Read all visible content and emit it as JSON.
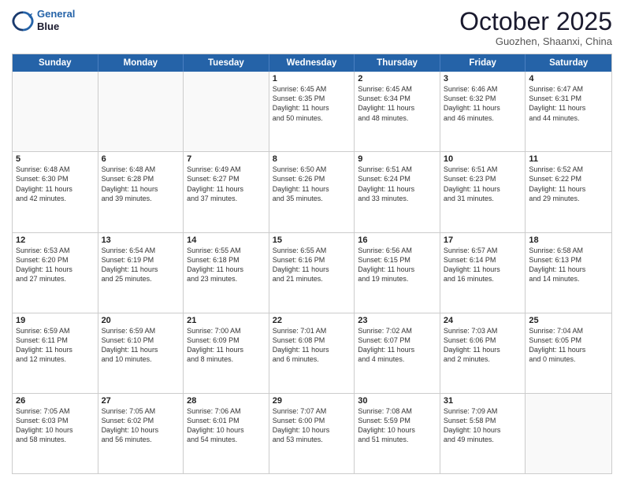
{
  "logo": {
    "line1": "General",
    "line2": "Blue"
  },
  "title": "October 2025",
  "subtitle": "Guozhen, Shaanxi, China",
  "dayHeaders": [
    "Sunday",
    "Monday",
    "Tuesday",
    "Wednesday",
    "Thursday",
    "Friday",
    "Saturday"
  ],
  "weeks": [
    [
      {
        "day": "",
        "info": ""
      },
      {
        "day": "",
        "info": ""
      },
      {
        "day": "",
        "info": ""
      },
      {
        "day": "1",
        "info": "Sunrise: 6:45 AM\nSunset: 6:35 PM\nDaylight: 11 hours\nand 50 minutes."
      },
      {
        "day": "2",
        "info": "Sunrise: 6:45 AM\nSunset: 6:34 PM\nDaylight: 11 hours\nand 48 minutes."
      },
      {
        "day": "3",
        "info": "Sunrise: 6:46 AM\nSunset: 6:32 PM\nDaylight: 11 hours\nand 46 minutes."
      },
      {
        "day": "4",
        "info": "Sunrise: 6:47 AM\nSunset: 6:31 PM\nDaylight: 11 hours\nand 44 minutes."
      }
    ],
    [
      {
        "day": "5",
        "info": "Sunrise: 6:48 AM\nSunset: 6:30 PM\nDaylight: 11 hours\nand 42 minutes."
      },
      {
        "day": "6",
        "info": "Sunrise: 6:48 AM\nSunset: 6:28 PM\nDaylight: 11 hours\nand 39 minutes."
      },
      {
        "day": "7",
        "info": "Sunrise: 6:49 AM\nSunset: 6:27 PM\nDaylight: 11 hours\nand 37 minutes."
      },
      {
        "day": "8",
        "info": "Sunrise: 6:50 AM\nSunset: 6:26 PM\nDaylight: 11 hours\nand 35 minutes."
      },
      {
        "day": "9",
        "info": "Sunrise: 6:51 AM\nSunset: 6:24 PM\nDaylight: 11 hours\nand 33 minutes."
      },
      {
        "day": "10",
        "info": "Sunrise: 6:51 AM\nSunset: 6:23 PM\nDaylight: 11 hours\nand 31 minutes."
      },
      {
        "day": "11",
        "info": "Sunrise: 6:52 AM\nSunset: 6:22 PM\nDaylight: 11 hours\nand 29 minutes."
      }
    ],
    [
      {
        "day": "12",
        "info": "Sunrise: 6:53 AM\nSunset: 6:20 PM\nDaylight: 11 hours\nand 27 minutes."
      },
      {
        "day": "13",
        "info": "Sunrise: 6:54 AM\nSunset: 6:19 PM\nDaylight: 11 hours\nand 25 minutes."
      },
      {
        "day": "14",
        "info": "Sunrise: 6:55 AM\nSunset: 6:18 PM\nDaylight: 11 hours\nand 23 minutes."
      },
      {
        "day": "15",
        "info": "Sunrise: 6:55 AM\nSunset: 6:16 PM\nDaylight: 11 hours\nand 21 minutes."
      },
      {
        "day": "16",
        "info": "Sunrise: 6:56 AM\nSunset: 6:15 PM\nDaylight: 11 hours\nand 19 minutes."
      },
      {
        "day": "17",
        "info": "Sunrise: 6:57 AM\nSunset: 6:14 PM\nDaylight: 11 hours\nand 16 minutes."
      },
      {
        "day": "18",
        "info": "Sunrise: 6:58 AM\nSunset: 6:13 PM\nDaylight: 11 hours\nand 14 minutes."
      }
    ],
    [
      {
        "day": "19",
        "info": "Sunrise: 6:59 AM\nSunset: 6:11 PM\nDaylight: 11 hours\nand 12 minutes."
      },
      {
        "day": "20",
        "info": "Sunrise: 6:59 AM\nSunset: 6:10 PM\nDaylight: 11 hours\nand 10 minutes."
      },
      {
        "day": "21",
        "info": "Sunrise: 7:00 AM\nSunset: 6:09 PM\nDaylight: 11 hours\nand 8 minutes."
      },
      {
        "day": "22",
        "info": "Sunrise: 7:01 AM\nSunset: 6:08 PM\nDaylight: 11 hours\nand 6 minutes."
      },
      {
        "day": "23",
        "info": "Sunrise: 7:02 AM\nSunset: 6:07 PM\nDaylight: 11 hours\nand 4 minutes."
      },
      {
        "day": "24",
        "info": "Sunrise: 7:03 AM\nSunset: 6:06 PM\nDaylight: 11 hours\nand 2 minutes."
      },
      {
        "day": "25",
        "info": "Sunrise: 7:04 AM\nSunset: 6:05 PM\nDaylight: 11 hours\nand 0 minutes."
      }
    ],
    [
      {
        "day": "26",
        "info": "Sunrise: 7:05 AM\nSunset: 6:03 PM\nDaylight: 10 hours\nand 58 minutes."
      },
      {
        "day": "27",
        "info": "Sunrise: 7:05 AM\nSunset: 6:02 PM\nDaylight: 10 hours\nand 56 minutes."
      },
      {
        "day": "28",
        "info": "Sunrise: 7:06 AM\nSunset: 6:01 PM\nDaylight: 10 hours\nand 54 minutes."
      },
      {
        "day": "29",
        "info": "Sunrise: 7:07 AM\nSunset: 6:00 PM\nDaylight: 10 hours\nand 53 minutes."
      },
      {
        "day": "30",
        "info": "Sunrise: 7:08 AM\nSunset: 5:59 PM\nDaylight: 10 hours\nand 51 minutes."
      },
      {
        "day": "31",
        "info": "Sunrise: 7:09 AM\nSunset: 5:58 PM\nDaylight: 10 hours\nand 49 minutes."
      },
      {
        "day": "",
        "info": ""
      }
    ]
  ]
}
